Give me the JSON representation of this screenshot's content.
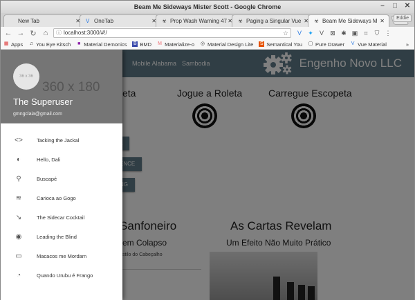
{
  "window": {
    "title": "Beam Me Sideways Mister Scott - Google Chrome"
  },
  "tabs": [
    {
      "icon": "",
      "label": "New Tab"
    },
    {
      "icon": "V",
      "label": "OneTab"
    },
    {
      "icon": "☣",
      "label": "Prop Wash Warning 47"
    },
    {
      "icon": "☣",
      "label": "Paging a Singular Vue"
    },
    {
      "icon": "☣",
      "label": "Beam Me Sideways M"
    }
  ],
  "profile_label": "Eddie",
  "address": {
    "url": "localhost:3000/#!/"
  },
  "bookmarks": [
    {
      "icon": "▦",
      "label": "Apps"
    },
    {
      "icon": "♫",
      "label": "You Eye Kitsch"
    },
    {
      "icon": "■",
      "label": "Material Demonics"
    },
    {
      "icon": "B",
      "label": "BMD"
    },
    {
      "icon": "M",
      "label": "Materialize-o"
    },
    {
      "icon": "◎",
      "label": "Material Design Lite"
    },
    {
      "icon": "S",
      "label": "Semantical You"
    },
    {
      "icon": "▢",
      "label": "Pure Drawer"
    },
    {
      "icon": "V",
      "label": "Vue Material"
    }
  ],
  "bookmarks_more": "»",
  "appbar": {
    "nav": [
      "Mobile Alabama",
      "Sambodia"
    ],
    "brand": "Engenho Novo LLC",
    "color": "#607d8b"
  },
  "content": {
    "col1_heading_partial": "eta",
    "col2_heading": "Jogue a Roleta",
    "col3_heading": "Carregue Escopeta",
    "button1_partial": "L",
    "button2_partial": "ENCE",
    "button3_partial": "NG",
    "section1_title_partial": "Sanfoneiro",
    "section1_subtitle_partial": "em Colapso",
    "section1_small_partial": "stilo do Cabeçalho",
    "section2_title": "As Cartas Revelam",
    "section2_subtitle": "Um Efeito Não Muito Prático"
  },
  "drawer": {
    "avatar_text": "36 x 36",
    "header_placeholder": "360 x 180",
    "user_name": "The Superuser",
    "user_email": "gmngclaia@gmail.com",
    "items": [
      {
        "icon": "code-icon",
        "glyph": "<>",
        "label": "Tacking the Jackal"
      },
      {
        "icon": "contrast-icon",
        "glyph": "◐",
        "label": "Hello, Dali"
      },
      {
        "icon": "search-icon",
        "glyph": "⚲",
        "label": "Buscapé"
      },
      {
        "icon": "beach-icon",
        "glyph": "≋",
        "label": "Carioca ao Gogo"
      },
      {
        "icon": "trending-down-icon",
        "glyph": "↘",
        "label": "The Sidecar Cocktail"
      },
      {
        "icon": "eye-icon",
        "glyph": "◉",
        "label": "Leading the Blind"
      },
      {
        "icon": "new-releases-icon",
        "glyph": "▭",
        "label": "Macacos me Mordam"
      },
      {
        "icon": "satellite-icon",
        "glyph": "◔",
        "label": "Quando Urubu é Frango"
      }
    ]
  }
}
